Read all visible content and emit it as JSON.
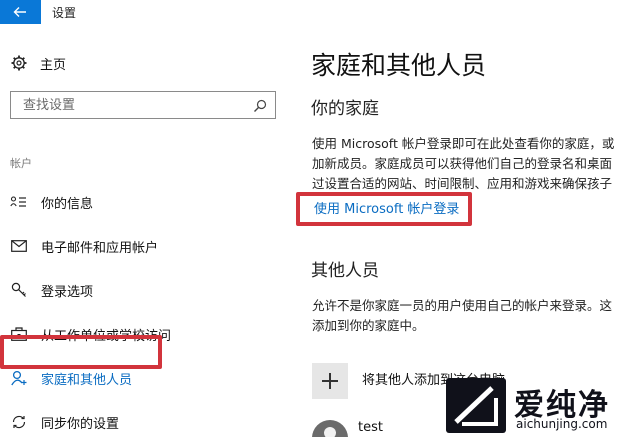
{
  "window": {
    "title": "设置",
    "back_icon": "arrow-left-icon",
    "accent_color": "#0a78d7"
  },
  "sidebar": {
    "home": {
      "label": "主页",
      "icon": "gear-icon"
    },
    "search": {
      "placeholder": "查找设置",
      "icon": "search-icon"
    },
    "section_label": "帐户",
    "items": [
      {
        "label": "你的信息",
        "icon": "person-card-icon"
      },
      {
        "label": "电子邮件和应用帐户",
        "icon": "mail-icon"
      },
      {
        "label": "登录选项",
        "icon": "key-icon"
      },
      {
        "label": "从工作单位或学校访问",
        "icon": "briefcase-icon"
      },
      {
        "label": "家庭和其他人员",
        "icon": "person-add-icon",
        "selected": true
      },
      {
        "label": "同步你的设置",
        "icon": "sync-icon"
      }
    ]
  },
  "main": {
    "title": "家庭和其他人员",
    "family": {
      "heading": "你的家庭",
      "lines": [
        "使用 Microsoft 帐户登录即可在此处查看你的家庭，或",
        "加新成员。家庭成员可以获得他们自己的登录名和桌面",
        "过设置合适的网站、时间限制、应用和游戏来确保孩子"
      ],
      "link": "使用 Microsoft 帐户登录"
    },
    "others": {
      "heading": "其他人员",
      "lines": [
        "允许不是你家庭一员的用户使用自己的帐户来登录。这",
        "添加到你的家庭中。"
      ],
      "add_label": "将其他人添加到这台电脑",
      "add_icon": "plus-icon",
      "users": [
        {
          "name": "test",
          "icon": "avatar-icon"
        }
      ]
    }
  },
  "highlight_color": "#d2343c",
  "watermark": {
    "text": "爱纯净",
    "url": "aichunjing.com"
  }
}
